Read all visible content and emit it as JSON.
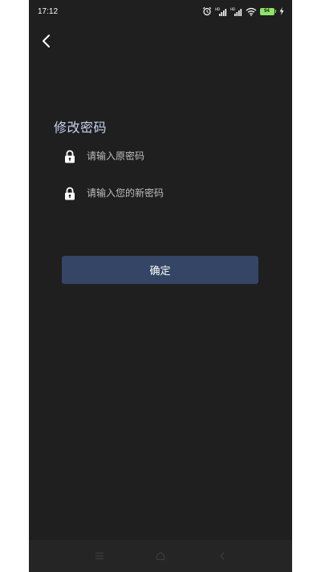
{
  "status_bar": {
    "time": "17:12",
    "battery_level": "94",
    "icons": [
      "alarm-icon",
      "signal-hd-icon",
      "signal-hd-icon",
      "wifi-icon",
      "battery-icon",
      "charging-icon"
    ]
  },
  "header": {
    "back_icon": "chevron-left-icon"
  },
  "form": {
    "title": "修改密码",
    "old_password": {
      "icon": "lock-icon",
      "placeholder": "请输入原密码",
      "value": ""
    },
    "new_password": {
      "icon": "lock-icon",
      "placeholder": "请输入您的新密码",
      "value": ""
    },
    "confirm_label": "确定"
  },
  "nav_bar": {
    "items": [
      "menu-icon",
      "home-icon",
      "back-icon"
    ]
  },
  "colors": {
    "background": "#1f1f1f",
    "title": "#c6d2f0",
    "button": "#344565",
    "battery": "#8fe36b"
  }
}
